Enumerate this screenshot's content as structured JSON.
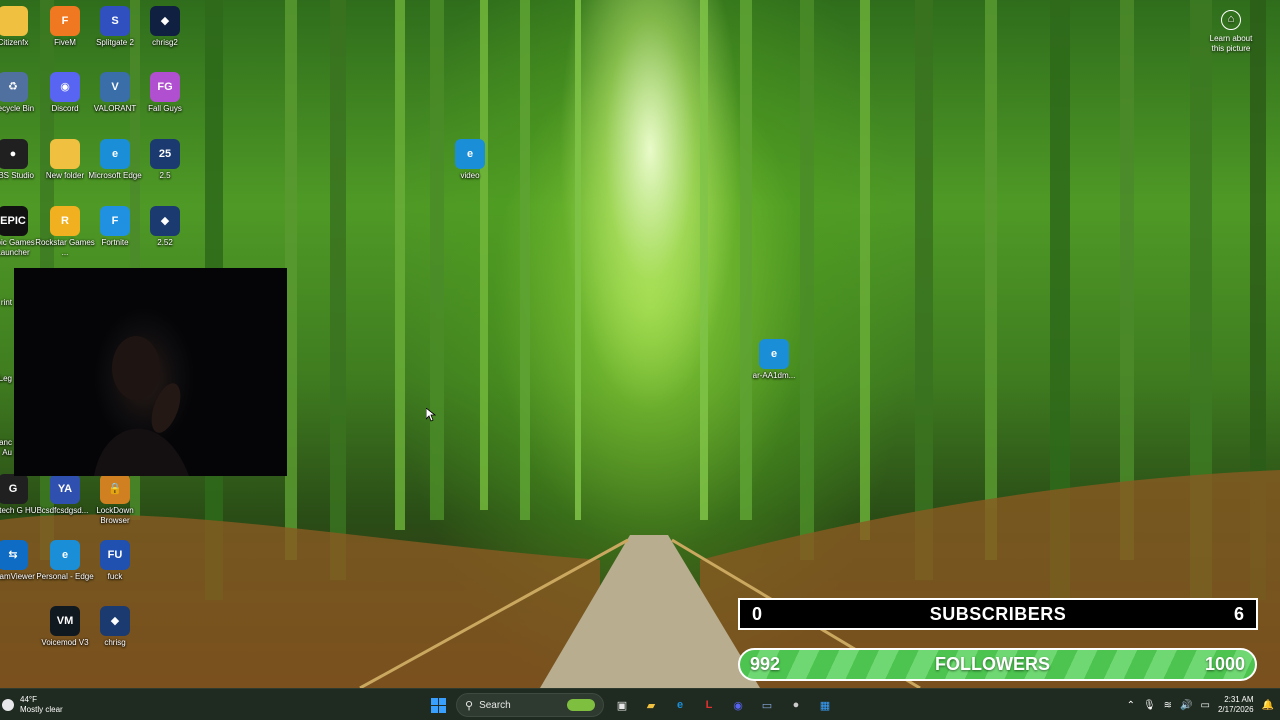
{
  "desktop": {
    "icons": [
      {
        "label": "Citizenfx",
        "glyph": "",
        "color": "#f0c040"
      },
      {
        "label": "FiveM",
        "glyph": "F",
        "color": "#f07820"
      },
      {
        "label": "Splitgate 2",
        "glyph": "S",
        "color": "#3050c0"
      },
      {
        "label": "chrisg2",
        "glyph": "◆",
        "color": "#102040"
      },
      {
        "label": "Recycle Bin",
        "glyph": "♻",
        "color": "#5070a0"
      },
      {
        "label": "Discord",
        "glyph": "◉",
        "color": "#5865f2"
      },
      {
        "label": "VALORANT",
        "glyph": "V",
        "color": "#3a6ea8"
      },
      {
        "label": "Fall Guys",
        "glyph": "FG",
        "color": "#b050d0"
      },
      {
        "label": "OBS Studio",
        "glyph": "●",
        "color": "#202020"
      },
      {
        "label": "New folder",
        "glyph": "",
        "color": "#f0c040"
      },
      {
        "label": "Microsoft Edge",
        "glyph": "e",
        "color": "#1a8fd8"
      },
      {
        "label": "2.5",
        "glyph": "25",
        "color": "#1a3a70"
      },
      {
        "label": "Epic Games Launcher",
        "glyph": "EPIC",
        "color": "#111111"
      },
      {
        "label": "Rockstar Games ...",
        "glyph": "R",
        "color": "#f0b020"
      },
      {
        "label": "Fortnite",
        "glyph": "F",
        "color": "#2090e0"
      },
      {
        "label": "2.52",
        "glyph": "◆",
        "color": "#1a3a70"
      },
      {
        "label": "Logitech G HUB",
        "glyph": "G",
        "color": "#202020"
      },
      {
        "label": "csdfcsdgsd...",
        "glyph": "YA",
        "color": "#3050b0"
      },
      {
        "label": "LockDown Browser",
        "glyph": "🔒",
        "color": "#d08020"
      },
      {
        "label": "TeamViewer",
        "glyph": "⇆",
        "color": "#0e6cc4"
      },
      {
        "label": "Personal - Edge",
        "glyph": "e",
        "color": "#1a8fd8"
      },
      {
        "label": "fuck",
        "glyph": "FU",
        "color": "#2050b0"
      },
      {
        "label": "Voicemod V3",
        "glyph": "VM",
        "color": "#101820"
      },
      {
        "label": "chrisg",
        "glyph": "◆",
        "color": "#1a3a70"
      },
      {
        "label": "video",
        "glyph": "e",
        "color": "#1a8fd8"
      },
      {
        "label": "ar-AA1dm...",
        "glyph": "e",
        "color": "#1a8fd8"
      }
    ],
    "partial_labels": [
      "rint",
      "Leg",
      "ranc Au"
    ],
    "learn_about": "Learn about this picture"
  },
  "stream_overlay": {
    "subscribers": {
      "current": "0",
      "title": "SUBSCRIBERS",
      "goal": "6"
    },
    "followers": {
      "current": "992",
      "title": "FOLLOWERS",
      "goal": "1000"
    }
  },
  "taskbar": {
    "weather_temp": "44°F",
    "weather_desc": "Mostly clear",
    "search_label": "Search",
    "pinned": [
      {
        "name": "task-view",
        "glyph": "▣",
        "color": "#e8e8e8"
      },
      {
        "name": "file-explorer",
        "glyph": "▰",
        "color": "#f0c040"
      },
      {
        "name": "edge",
        "glyph": "e",
        "color": "#1a8fd8"
      },
      {
        "name": "lockdown-l",
        "glyph": "L",
        "color": "#e03030"
      },
      {
        "name": "discord",
        "glyph": "◉",
        "color": "#5865f2"
      },
      {
        "name": "terminal",
        "glyph": "▭",
        "color": "#8ad"
      },
      {
        "name": "obs",
        "glyph": "●",
        "color": "#cccccc"
      },
      {
        "name": "media",
        "glyph": "▦",
        "color": "#3aa0ff"
      }
    ],
    "time": "2:31 AM",
    "date": "2/17/2026"
  }
}
